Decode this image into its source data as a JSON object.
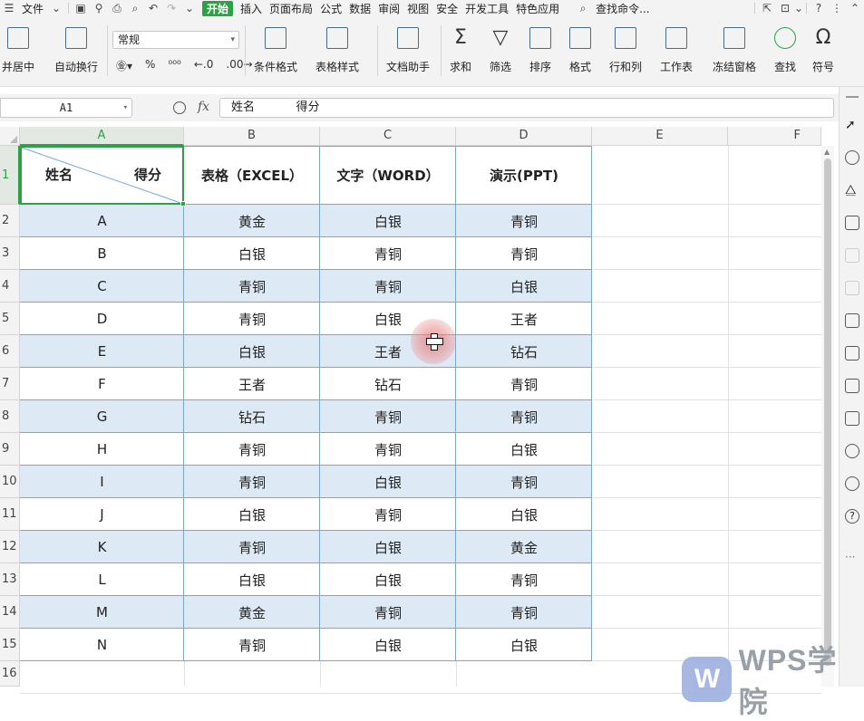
{
  "menubar": {
    "file": "文件",
    "tabs": [
      "开始",
      "插入",
      "页面布局",
      "公式",
      "数据",
      "审阅",
      "视图",
      "安全",
      "开发工具",
      "特色应用"
    ],
    "search": "查找命令..."
  },
  "ribbon": {
    "merge": "并居中",
    "wrap": "自动换行",
    "number_format": "常规",
    "cond_format": "条件格式",
    "table_style": "表格样式",
    "doc_helper": "文档助手",
    "sum": "求和",
    "filter": "筛选",
    "sort": "排序",
    "format": "格式",
    "row_col": "行和列",
    "worksheet": "工作表",
    "freeze": "冻结窗格",
    "find": "查找",
    "symbol": "符号"
  },
  "formula_bar": {
    "name_box": "A1",
    "fx": "fx",
    "content": "姓名           得分"
  },
  "columns": [
    "A",
    "B",
    "C",
    "D",
    "E",
    "F"
  ],
  "rows": [
    "1",
    "2",
    "3",
    "4",
    "5",
    "6",
    "7",
    "8",
    "9",
    "10",
    "11",
    "12",
    "13",
    "14",
    "15",
    "16"
  ],
  "header": {
    "name": "姓名",
    "score": "得分",
    "excel": "表格（EXCEL）",
    "word": "文字（WORD）",
    "ppt": "演示(PPT)"
  },
  "data": [
    [
      "A",
      "黄金",
      "白银",
      "青铜"
    ],
    [
      "B",
      "白银",
      "青铜",
      "青铜"
    ],
    [
      "C",
      "青铜",
      "青铜",
      "白银"
    ],
    [
      "D",
      "青铜",
      "白银",
      "王者"
    ],
    [
      "E",
      "白银",
      "王者",
      "钻石"
    ],
    [
      "F",
      "王者",
      "钻石",
      "青铜"
    ],
    [
      "G",
      "钻石",
      "青铜",
      "青铜"
    ],
    [
      "H",
      "青铜",
      "青铜",
      "白银"
    ],
    [
      "I",
      "青铜",
      "白银",
      "青铜"
    ],
    [
      "J",
      "白银",
      "青铜",
      "白银"
    ],
    [
      "K",
      "青铜",
      "白银",
      "黄金"
    ],
    [
      "L",
      "白银",
      "白银",
      "青铜"
    ],
    [
      "M",
      "黄金",
      "青铜",
      "青铜"
    ],
    [
      "N",
      "青铜",
      "白银",
      "白银"
    ]
  ],
  "watermark": "WPS学院",
  "colors": {
    "accent": "#2ba245",
    "band": "#dde9f5",
    "border": "#7aa6d2"
  }
}
